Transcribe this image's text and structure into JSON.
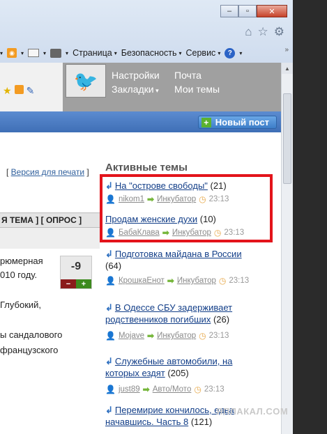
{
  "window": {
    "minimize": "‒",
    "maximize": "▫",
    "close": "✕"
  },
  "toolbar": {
    "rss_icon": "rss-icon",
    "print_icon": "printer-icon",
    "page_menu": "Страница",
    "security_menu": "Безопасность",
    "service_menu": "Сервис",
    "help_icon": "help-icon",
    "chevron": "»"
  },
  "header": {
    "menu": {
      "settings": "Настройки",
      "mail": "Почта",
      "bookmarks": "Закладки",
      "my_topics": "Мои темы"
    },
    "new_post_label": "Новый пост"
  },
  "left": {
    "print_prefix": "[ ",
    "print_link": "Версия для печати",
    "print_suffix": " ]",
    "tema_bar": "Я ТЕМА ] [ ОПРОС ]",
    "post_lines": [
      "рюмерная",
      "010 году.",
      "Глубокий,",
      "ы сандалового",
      "французского"
    ],
    "vote_value": "-9",
    "vote_minus": "−",
    "vote_plus": "+"
  },
  "active_topics": {
    "title": "Активные темы",
    "items": [
      {
        "title": "На \"острове свободы\"",
        "count": "(21)",
        "user": "nikom1",
        "section": "Инкубатор",
        "time": "23:13",
        "title_linked": true
      },
      {
        "title": "Продам женские духи",
        "count": "(10)",
        "user": "БабаКлава",
        "section": "Инкубатор",
        "time": "23:13",
        "title_linked": true
      },
      {
        "title": "Подготовка майдана в России",
        "count": "(64)",
        "user": "КрошкаЕнот",
        "section": "Инкубатор",
        "time": "23:13",
        "title_linked": true
      },
      {
        "title": "В Одессе СБУ задерживает родственников погибших",
        "count": "(26)",
        "user": "Mojave",
        "section": "Инкубатор",
        "time": "23:13",
        "title_linked": true
      },
      {
        "title": "Служебные автомобили, на которых ездят",
        "count": "(205)",
        "user": "just89",
        "section": "Авто/Мото",
        "time": "23:13",
        "title_linked": true
      },
      {
        "title": "Перемирие кончилось, едва начавшись. Часть 8",
        "count": "(121)",
        "title_linked": true
      }
    ]
  },
  "watermark": "ЯПЛАКАЛ.COM",
  "colors": {
    "highlight_border": "#e3141b",
    "header_bar": "#3f6fb6",
    "link": "#123e88"
  }
}
